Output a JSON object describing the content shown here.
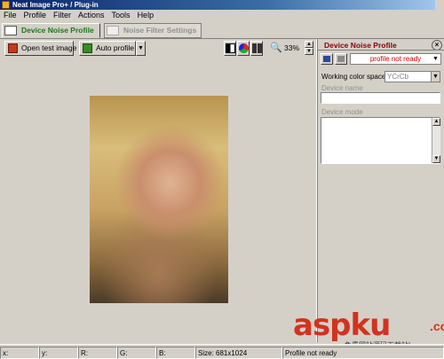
{
  "window": {
    "title": "Neat Image Pro+ / Plug-in"
  },
  "menu": [
    "File",
    "Profile",
    "Filter",
    "Actions",
    "Tools",
    "Help"
  ],
  "tabs": [
    {
      "label": "Device Noise Profile",
      "active": true
    },
    {
      "label": "Noise Filter Settings",
      "active": false
    }
  ],
  "toolbar": {
    "open_test_image": "Open test image",
    "auto_profile": "Auto profile",
    "zoom": "33%"
  },
  "right_panel": {
    "title": "Device Noise Profile",
    "profile_status": "profile not ready",
    "working_color_space_label": "Working color space:",
    "working_color_space_value": "YCrCb",
    "device_name_label": "Device name",
    "device_mode_label": "Device mode"
  },
  "statusbar": {
    "x": "x:",
    "y": "y:",
    "r": "R:",
    "g": "G:",
    "b": "B:",
    "size": "Size: 681x1024",
    "profile": "Profile not ready"
  },
  "watermark": {
    "brand": "aspku",
    "dot": ".com",
    "sub": "免费网站源码下载站!"
  },
  "colors": {
    "titlebar": "#0a246a",
    "active_tab_text": "#1a7a1a",
    "panel_title": "#8b0000",
    "profile_status": "#cc0000",
    "watermark": "#d2321e"
  }
}
